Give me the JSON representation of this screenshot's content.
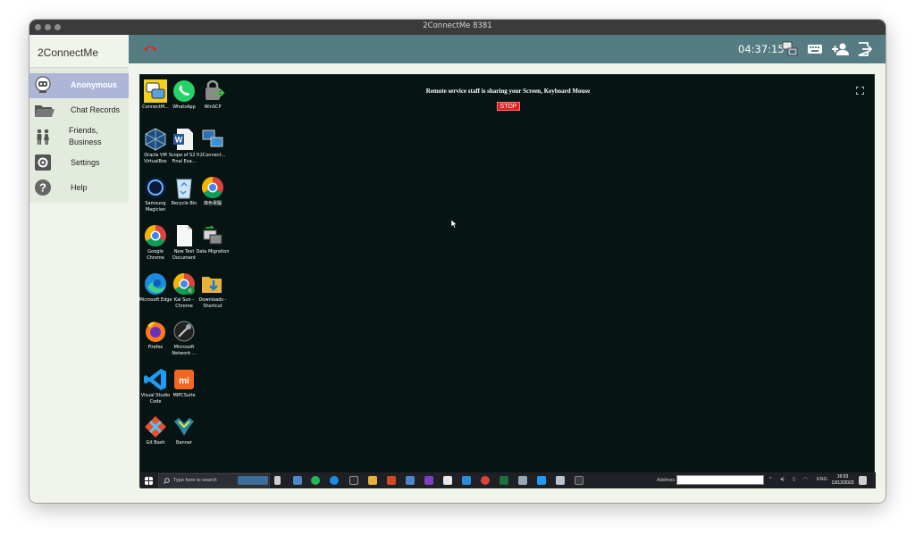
{
  "window": {
    "title": "2ConnectMe 8381"
  },
  "sidebar": {
    "app_name": "2ConnectMe",
    "items": [
      {
        "label": "Anonymous",
        "icon": "robot-avatar-icon",
        "active": true
      },
      {
        "label": "Chat Records",
        "icon": "folder-icon",
        "active": false
      },
      {
        "label": "Friends, Business",
        "icon": "people-icon",
        "active": false
      },
      {
        "label": "Settings",
        "icon": "gear-icon",
        "active": false
      },
      {
        "label": "Help",
        "icon": "question-icon",
        "active": false
      }
    ]
  },
  "header": {
    "time": "04:37:15",
    "icons": [
      "hangup-icon",
      "screen-share-icon",
      "keyboard-icon",
      "add-user-icon",
      "exit-icon"
    ]
  },
  "remote": {
    "banner": "Remote service staff is sharing your Screen, Keyboard Mouse",
    "stop_label": "STOP",
    "desktop_icons": [
      {
        "label": "ConnectM...",
        "icon": "connectme-app-icon"
      },
      {
        "label": "WhatsApp",
        "icon": "whatsapp-icon"
      },
      {
        "label": "WinSCP",
        "icon": "winscp-icon"
      },
      {
        "label": "Oracle VM VirtualBox",
        "icon": "virtualbox-icon"
      },
      {
        "label": "Scope of S2 fi Final Exa...",
        "icon": "word-document-icon"
      },
      {
        "label": "2Connect...",
        "icon": "network-app-icon"
      },
      {
        "label": "Samsung Magician",
        "icon": "samsung-magician-icon"
      },
      {
        "label": "Recycle Bin",
        "icon": "recycle-bin-icon"
      },
      {
        "label": "綠色電腦",
        "icon": "chrome-icon"
      },
      {
        "label": "Google Chrome",
        "icon": "chrome-icon"
      },
      {
        "label": "New Text Document",
        "icon": "text-document-icon"
      },
      {
        "label": "Data Migration",
        "icon": "data-migration-icon"
      },
      {
        "label": "Microsoft Edge",
        "icon": "edge-icon"
      },
      {
        "label": "Kai Sun - Chrome",
        "icon": "chrome-profile-icon"
      },
      {
        "label": "Downloads - Shortcut",
        "icon": "downloads-folder-icon"
      },
      {
        "label": "Firefox",
        "icon": "firefox-icon"
      },
      {
        "label": "Microsoft Network ...",
        "icon": "network-monitor-icon"
      },
      {
        "label": "Visual Studio Code",
        "icon": "vscode-icon"
      },
      {
        "label": "MIPCSuite",
        "icon": "mi-icon"
      },
      {
        "label": "Git Bash",
        "icon": "git-bash-icon"
      },
      {
        "label": "Banner",
        "icon": "banner-app-icon"
      }
    ],
    "taskbar": {
      "search_placeholder": "Type here to search",
      "address_label": "Address",
      "lang": "ENG",
      "time": "16:03",
      "date": "13/12/2023"
    }
  },
  "colors": {
    "header": "#567c83",
    "sidebar_active": "#aeb6d8",
    "remote_bg": "#061513",
    "stop": "#e61c1c"
  }
}
